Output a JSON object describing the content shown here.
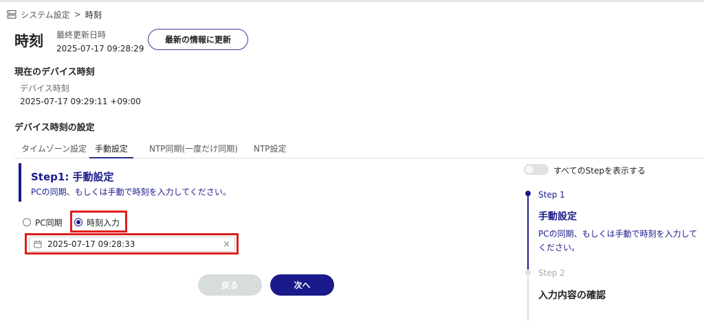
{
  "breadcrumb": {
    "parent": "システム設定",
    "separator": ">",
    "current": "時刻"
  },
  "header": {
    "title": "時刻",
    "last_updated_label": "最終更新日時",
    "last_updated_value": "2025-07-17 09:28:29",
    "refresh_label": "最新の情報に更新"
  },
  "current_device": {
    "section_title": "現在のデバイス時刻",
    "label": "デバイス時刻",
    "value": "2025-07-17 09:29:11 +09:00"
  },
  "settings": {
    "section_title": "デバイス時刻の設定",
    "tabs": [
      {
        "label": "タイムゾーン設定",
        "active": false
      },
      {
        "label": "手動設定",
        "active": true
      },
      {
        "label": "NTP同期(一度だけ同期)",
        "active": false
      },
      {
        "label": "NTP設定",
        "active": false
      }
    ]
  },
  "step": {
    "title": "Step1: 手動設定",
    "description": "PCの同期、もしくは手動で時刻を入力してください。",
    "radio_options": [
      {
        "label": "PC同期",
        "checked": false
      },
      {
        "label": "時刻入力",
        "checked": true
      }
    ],
    "datetime_value": "2025-07-17 09:28:33",
    "clear_icon": "×"
  },
  "buttons": {
    "back": "戻る",
    "next": "次へ"
  },
  "sidebar": {
    "toggle_label": "すべてのStepを表示する",
    "steps": [
      {
        "label": "Step 1",
        "title": "手動設定",
        "description": "PCの同期、もしくは手動で時刻を入力してください。"
      },
      {
        "label": "Step 2",
        "title": "入力内容の確認"
      }
    ]
  },
  "colors": {
    "accent": "#1a1a8c",
    "highlight": "#e01b1b",
    "disabled_button": "#d7dcdc"
  }
}
